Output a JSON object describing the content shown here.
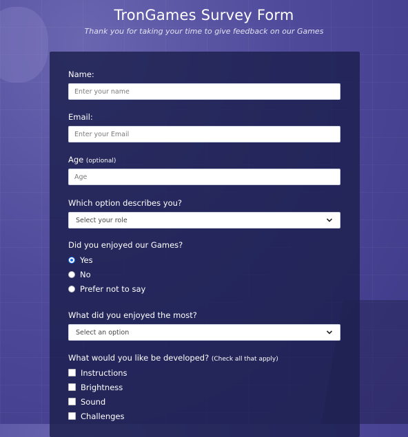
{
  "header": {
    "title": "TronGames Survey Form",
    "subtitle": "Thank you for taking your time to give feedback on our Games"
  },
  "form": {
    "name": {
      "label": "Name:",
      "placeholder": "Enter your name"
    },
    "email": {
      "label": "Email:",
      "placeholder": "Enter your Email"
    },
    "age": {
      "label": "Age",
      "hint": "(optional)",
      "placeholder": "Age"
    },
    "role": {
      "label": "Which option describes you?",
      "selected": "Select your role"
    },
    "enjoyed": {
      "label": "Did you enjoyed our Games?",
      "options": [
        "Yes",
        "No",
        "Prefer not to say"
      ],
      "selected": "Yes"
    },
    "most": {
      "label": "What did you enjoyed the most?",
      "selected": "Select an option"
    },
    "develop": {
      "label": "What would you like be developed?",
      "hint": "(Check all that apply)",
      "options": [
        "Instructions",
        "Brightness",
        "Sound",
        "Challenges"
      ]
    }
  },
  "colors": {
    "background": "#4f4a9a",
    "card": "#1c204e",
    "accent": "#1a73e8"
  },
  "icons": {
    "select_arrow": "chevron-down-icon"
  }
}
